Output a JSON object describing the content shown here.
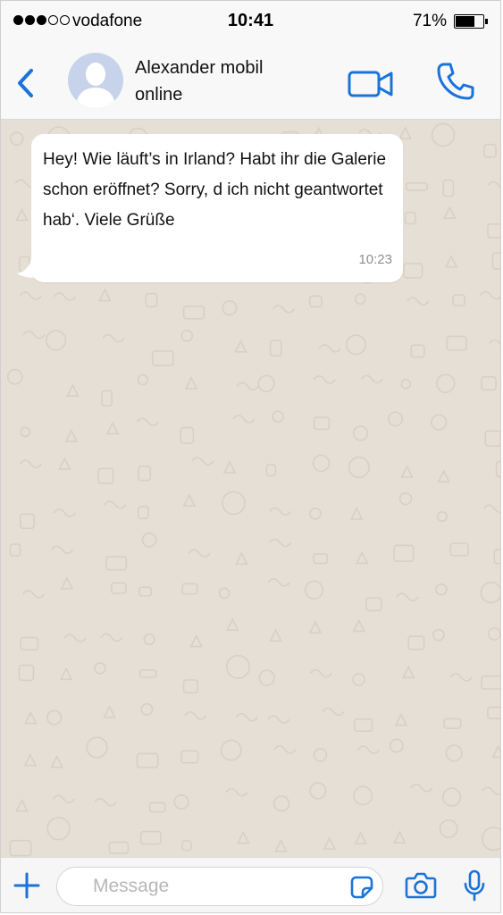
{
  "status_bar": {
    "signal_bars_filled": 3,
    "signal_bars_total": 5,
    "carrier": "vodafone",
    "time": "10:41",
    "battery_percent_label": "71%",
    "battery_level": 0.71
  },
  "header": {
    "back_icon": "chevron-left-icon",
    "contact_name": "Alexander mobil",
    "contact_status": "online",
    "video_icon": "video-camera-icon",
    "call_icon": "phone-icon"
  },
  "messages": [
    {
      "direction": "incoming",
      "text": "Hey! Wie läuft’s in Irland? Habt ihr die Galerie schon eröffnet? Sorry, d ich nicht geantwortet hab‘. Viele Grüße",
      "time": "10:23"
    }
  ],
  "composer": {
    "placeholder": "Message",
    "value": "",
    "plus_icon": "plus-icon",
    "sticker_icon": "sticker-icon",
    "camera_icon": "camera-icon",
    "mic_icon": "microphone-icon"
  },
  "colors": {
    "accent": "#1a73d9",
    "chat_background": "#e6dfd5",
    "bar_background": "#f8f8f8",
    "bubble_incoming": "#ffffff"
  }
}
